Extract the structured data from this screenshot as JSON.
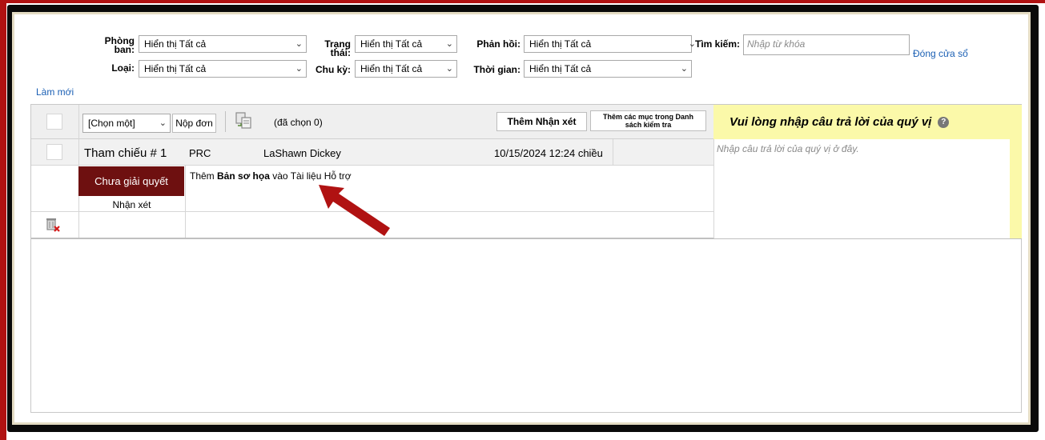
{
  "filters": {
    "department": {
      "label_line1": "Phòng",
      "label_line2": "ban:",
      "value": "Hiển thị Tất cả"
    },
    "type": {
      "label": "Loại:",
      "value": "Hiển thị Tất cả"
    },
    "status": {
      "label_line1": "Trạng",
      "label_line2": "thái:",
      "value": "Hiển thị Tất cả"
    },
    "cycle": {
      "label": "Chu kỳ:",
      "value": "Hiển thị Tất cả"
    },
    "response": {
      "label": "Phản hồi:",
      "value": "Hiển thị Tất cả"
    },
    "time": {
      "label": "Thời gian:",
      "value": "Hiển thị Tất cả"
    },
    "search": {
      "label": "Tìm kiếm:",
      "placeholder": "Nhập từ khóa"
    },
    "close_window": "Đóng cửa sổ",
    "refresh": "Làm mới"
  },
  "toolbar": {
    "action_select": "[Chọn một]",
    "submit_label": "Nộp đơn",
    "selected_count": "(đã chọn 0)",
    "add_comment_label": "Thêm Nhận xét",
    "add_checklist_label_line1": "Thêm các mục trong Danh",
    "add_checklist_label_line2": "sách kiểm tra"
  },
  "answer_panel": {
    "title": "Vui lòng nhập câu trả lời của quý vị",
    "placeholder": "Nhập câu trả lời của quý vị ở đây."
  },
  "rows": [
    {
      "reference": "Tham chiếu # 1",
      "code": "PRC",
      "person": "LaShawn Dickey",
      "datetime": "10/15/2024 12:24 chiều",
      "status": "Chưa giải quyết",
      "comment_label": "Nhận xét",
      "desc_prefix": "Thêm ",
      "desc_bold": "Bản sơ họa",
      "desc_suffix": " vào Tài liệu Hỗ trợ"
    }
  ],
  "colors": {
    "accent_red": "#b01212",
    "status_bg": "#6e1010",
    "answer_bg": "#fbf9a9",
    "link": "#1a5fb4",
    "arrow": "#b01212"
  }
}
